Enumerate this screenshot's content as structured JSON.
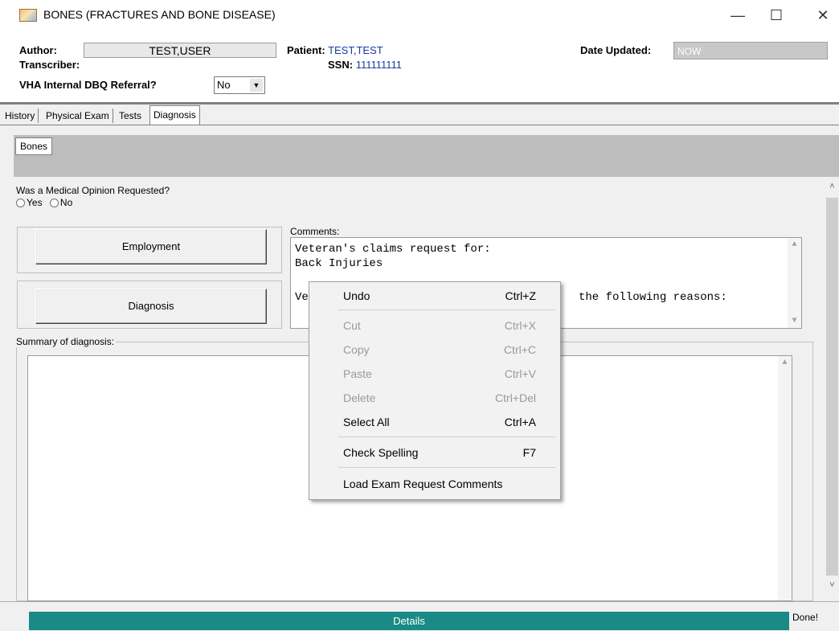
{
  "window": {
    "title": "BONES (FRACTURES AND BONE DISEASE)",
    "minimize_glyph": "—",
    "maximize_glyph": "☐",
    "close_glyph": "✕"
  },
  "header": {
    "author_label": "Author:",
    "author_value": "TEST,USER",
    "transcriber_label": "Transcriber:",
    "dbq_label": "VHA Internal DBQ Referral?",
    "dbq_value": "No",
    "patient_label": "Patient:",
    "patient_value": "TEST,TEST",
    "ssn_label": "SSN:",
    "ssn_value": "111111111",
    "date_updated_label": "Date Updated:",
    "date_updated_value": "NOW"
  },
  "tabs": [
    "History",
    "Physical Exam",
    "Tests",
    "Diagnosis"
  ],
  "active_tab": "Diagnosis",
  "subtabs": [
    "Bones"
  ],
  "form": {
    "question": "Was a Medical Opinion Requested?",
    "radio_yes": "Yes",
    "radio_no": "No",
    "employment_button": "Employment",
    "diagnosis_button": "Diagnosis",
    "comments_label": "Comments:",
    "comments_line1": "Veteran's claims request for:",
    "comments_line2": "Back Injuries",
    "comments_line3_start": "Ve",
    "comments_line3_end": "the following reasons:",
    "summary_label": "Summary of diagnosis:"
  },
  "context_menu": [
    {
      "label": "Undo",
      "shortcut": "Ctrl+Z",
      "enabled": true
    },
    {
      "label": "Cut",
      "shortcut": "Ctrl+X",
      "enabled": false
    },
    {
      "label": "Copy",
      "shortcut": "Ctrl+C",
      "enabled": false
    },
    {
      "label": "Paste",
      "shortcut": "Ctrl+V",
      "enabled": false
    },
    {
      "label": "Delete",
      "shortcut": "Ctrl+Del",
      "enabled": false
    },
    {
      "label": "Select All",
      "shortcut": "Ctrl+A",
      "enabled": true
    },
    {
      "label": "Check Spelling",
      "shortcut": "F7",
      "enabled": true
    },
    {
      "label": "Load Exam Request Comments",
      "shortcut": "",
      "enabled": true
    }
  ],
  "status": {
    "details_label": "Details",
    "done_label": "Done!"
  },
  "colors": {
    "patient_blue": "#1a3aa0",
    "details_bar": "#1a8a86"
  }
}
